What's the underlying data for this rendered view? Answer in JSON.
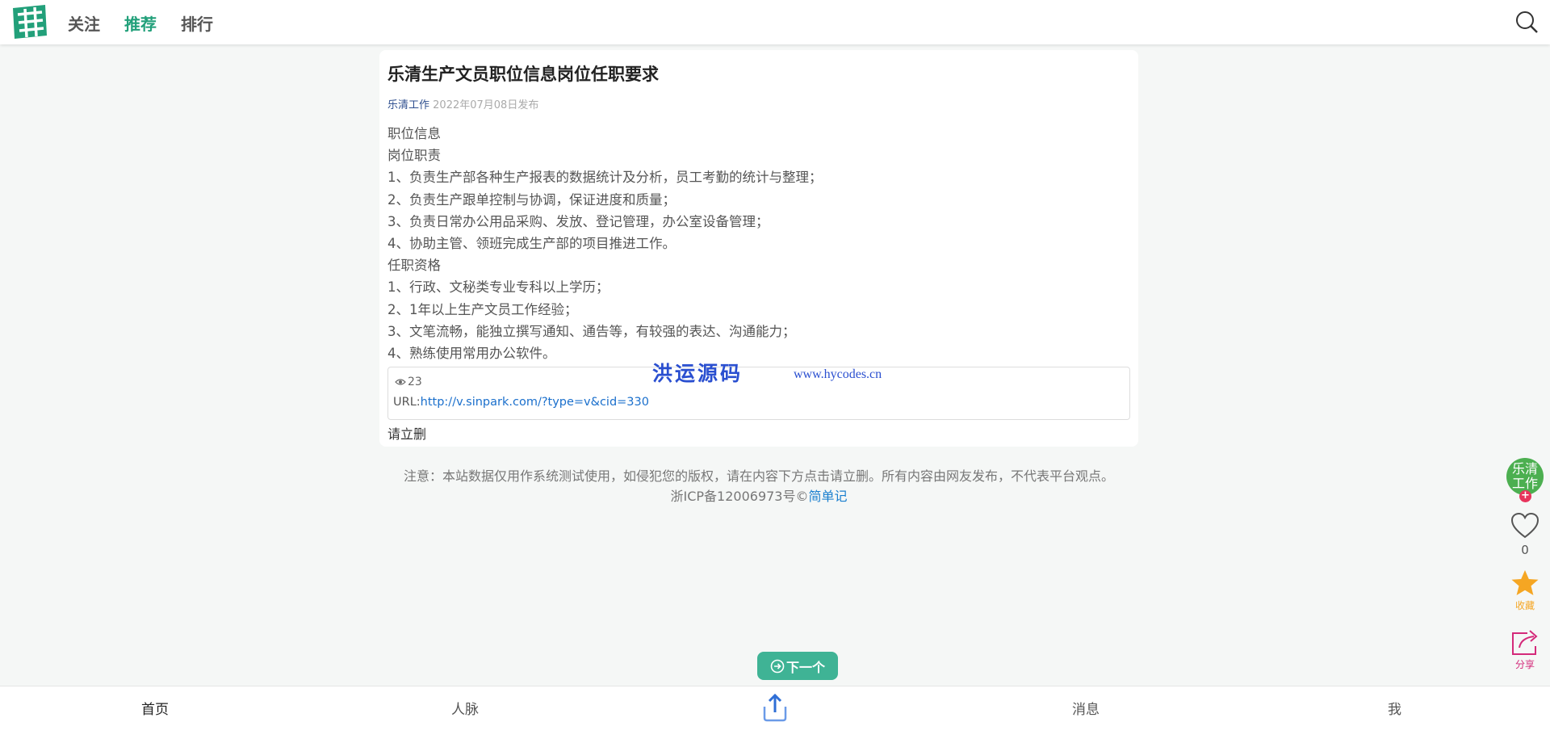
{
  "header": {
    "tabs": [
      {
        "label": "关注"
      },
      {
        "label": "推荐"
      },
      {
        "label": "排行"
      }
    ],
    "active_tab": "推荐"
  },
  "article": {
    "title": "乐清生产文员职位信息岗位任职要求",
    "author": "乐清工作",
    "published": "2022年07月08日发布",
    "lines": [
      "职位信息",
      "岗位职责",
      "1、负责生产部各种生产报表的数据统计及分析，员工考勤的统计与整理；",
      "2、负责生产跟单控制与协调，保证进度和质量；",
      "3、负责日常办公用品采购、发放、登记管理，办公室设备管理；",
      "4、协助主管、领班完成生产部的项目推进工作。",
      "任职资格",
      "1、行政、文秘类专业专科以上学历；",
      "2、1年以上生产文员工作经验；",
      "3、文笔流畅，能独立撰写通知、通告等，有较强的表达、沟通能力；",
      "4、熟练使用常用办公软件。"
    ],
    "views": "23",
    "url_label": "URL:",
    "url": "http://v.sinpark.com/?type=v&cid=330",
    "report_label": "请立删"
  },
  "watermark": {
    "cn": "洪运源码",
    "url": "www.hycodes.cn"
  },
  "notice": {
    "text": "注意：本站数据仅用作系统测试使用，如侵犯您的版权，请在内容下方点击请立删。所有内容由网友发布，不代表平台观点。",
    "icp": "浙ICP备12006973号©",
    "brand_link": "简单记"
  },
  "sidebar": {
    "avatar_text": "乐清工作",
    "follow_symbol": "+",
    "like_count": "0",
    "favorite_label": "收藏",
    "share_label": "分享"
  },
  "next_label": "下一个",
  "bottom_nav": {
    "home": "首页",
    "contacts": "人脉",
    "messages": "消息",
    "me": "我"
  },
  "colors": {
    "accent": "#22a07a",
    "next_button": "#3fb395",
    "link": "#1a6fcc",
    "favorite": "#f5a623",
    "share": "#d42a7a",
    "follow_badge": "#e8345c"
  }
}
